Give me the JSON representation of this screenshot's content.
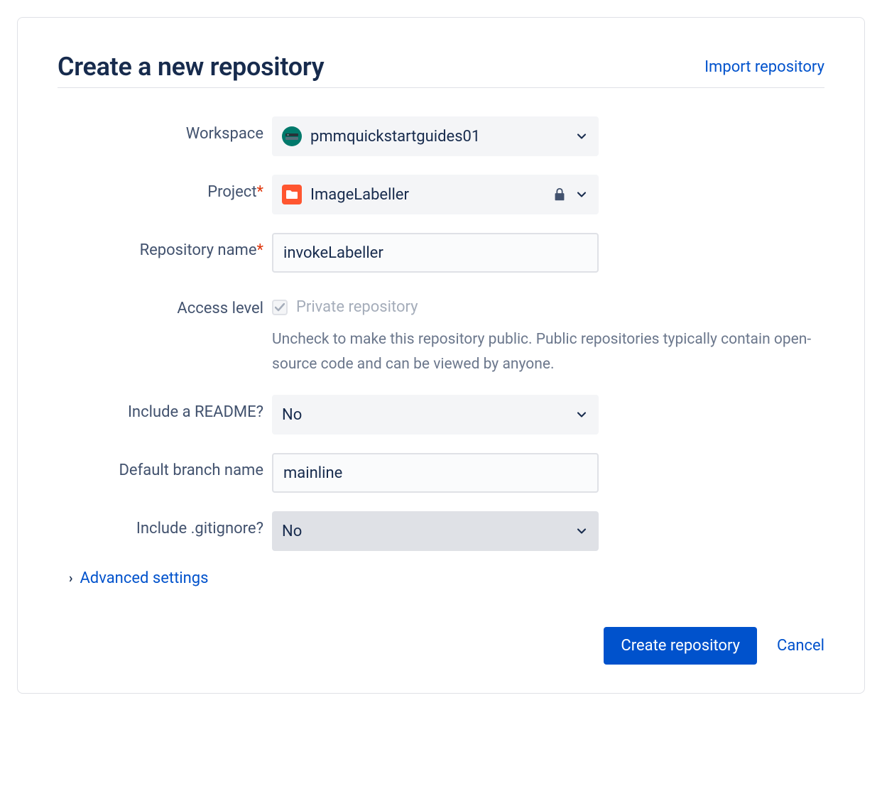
{
  "header": {
    "title": "Create a new repository",
    "import_link": "Import repository"
  },
  "form": {
    "workspace": {
      "label": "Workspace",
      "value": "pmmquickstartguides01"
    },
    "project": {
      "label": "Project",
      "value": "ImageLabeller"
    },
    "repo_name": {
      "label": "Repository name",
      "value": "invokeLabeller"
    },
    "access": {
      "label": "Access level",
      "checkbox_label": "Private repository",
      "help": "Uncheck to make this repository public. Public repositories typically contain open-source code and can be viewed by anyone."
    },
    "readme": {
      "label": "Include a README?",
      "value": "No"
    },
    "branch": {
      "label": "Default branch name",
      "value": "mainline"
    },
    "gitignore": {
      "label": "Include .gitignore?",
      "value": "No"
    },
    "advanced": {
      "label": "Advanced settings"
    }
  },
  "footer": {
    "create": "Create repository",
    "cancel": "Cancel"
  }
}
